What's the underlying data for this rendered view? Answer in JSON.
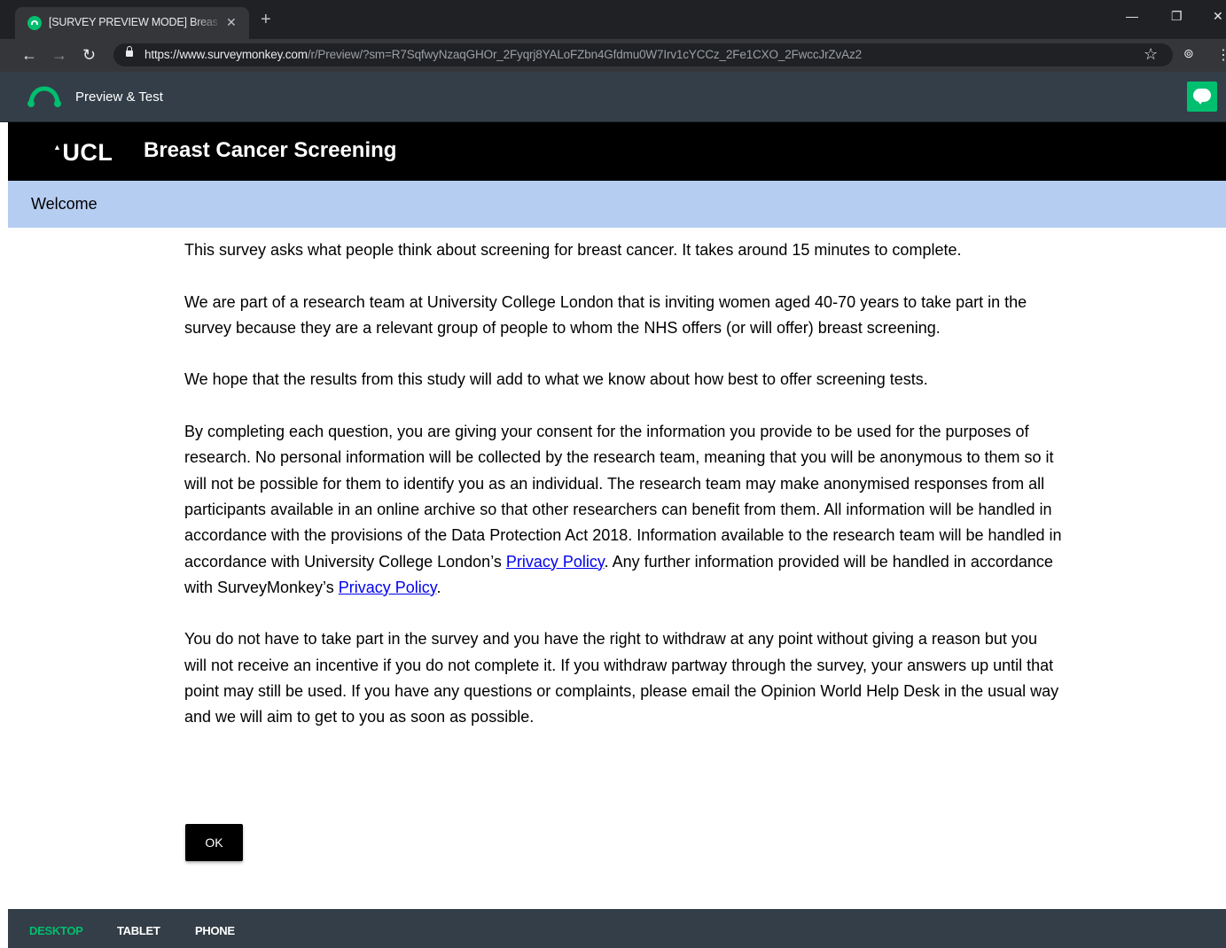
{
  "browser": {
    "tab_title": "[SURVEY PREVIEW MODE] Breast Cancer Screening",
    "tab_close": "✕",
    "new_tab": "+",
    "url_host": "https://www.surveymonkey.com",
    "url_path": "/r/Preview/?sm=R7SqfwyNzaqGHOr_2Fyqrj8YALoFZbn4Gfdmu0W7Irv1cYCCz_2Fe1CXO_2FwccJrZvAz2",
    "icons": [
      "back-icon",
      "forward-icon",
      "reload-icon",
      "lock-icon",
      "star-icon",
      "incognito-icon",
      "menu-icon"
    ]
  },
  "preview_bar": {
    "label": "Preview & Test",
    "brand_color": "#00bf6f"
  },
  "survey": {
    "logo": "UCL",
    "title": "Breast Cancer Screening",
    "page_title": "Welcome",
    "paragraphs": [
      "This survey asks what people think about screening for breast cancer. It takes around 15 minutes to complete.",
      "We are part of a research team at University College London that is inviting women aged 40-70 years to take part in the survey because they are a relevant group of people to whom the NHS offers (or will offer) breast screening.",
      "We hope that the results from this study will add to what we know about how best to offer screening tests."
    ],
    "consent_text_1": "By completing each question, you are giving your consent for the information you provide to be used for the purposes of research. No personal information will be collected by the research team, meaning that you will be anonymous to them so it will not be possible for them to identify you as an individual. The research team may make anonymised responses from all participants available in an online archive so that other researchers can benefit from them. All information will be handled in accordance with the provisions of the Data Protection Act 2018. Information available to the research team will be handled in accordance with University College London’s ",
    "privacy_link_1": "Privacy Policy",
    "consent_text_2": ". Any further information provided will be handled in accordance with SurveyMonkey’s ",
    "privacy_link_2": "Privacy Policy",
    "consent_text_3": ".",
    "withdraw_text": "You do not have to take part in the survey and you have the right to withdraw at any point without giving a reason but you will not receive an incentive if you do not complete it. If you withdraw partway through the survey, your answers up until that point may still be used. If you have any questions or complaints, please email the Opinion World Help Desk in the usual way and we will aim to get to you as soon as possible.",
    "ok_label": "OK"
  },
  "device_bar": {
    "tabs": [
      "DESKTOP",
      "TABLET",
      "PHONE"
    ],
    "active": "DESKTOP"
  }
}
